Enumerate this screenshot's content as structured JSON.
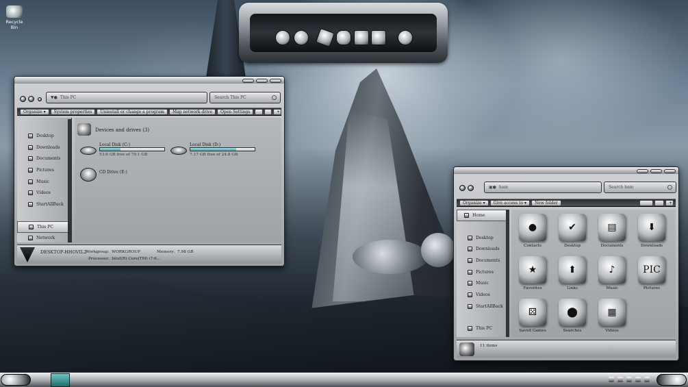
{
  "desktop": {
    "recycle_bin": "Recycle Bin"
  },
  "window1": {
    "address": "This PC",
    "search_placeholder": "Search This PC",
    "commands": [
      "Organize ▾",
      "System properties",
      "Uninstall or change a program",
      "Map network drive",
      "Open Settings"
    ],
    "nav_items": [
      "Desktop",
      "Downloads",
      "Documents",
      "Pictures",
      "Music",
      "Videos",
      "StartAllBack"
    ],
    "nav_selected": "This PC",
    "nav_network": "Network",
    "group_title": "Devices and drives (3)",
    "drives": [
      {
        "name": "Local Disk (C:)",
        "free": "53.6 GB free of 79.1 GB",
        "used_fraction": 0.32
      },
      {
        "name": "Local Disk (D:)",
        "free": "7.17 GB free of 24.8 GB",
        "used_fraction": 0.71
      }
    ],
    "cd_drive": "CD Drive (E:)",
    "status": {
      "computer": "DESKTOP-HHOVIL2",
      "workgroup_label": "Workgroup:",
      "workgroup": "WORKGROUP",
      "memory_label": "Memory:",
      "memory": "7.98 GB",
      "processor_label": "Processor:",
      "processor": "Intel(R) Core(TM) i7-6..."
    }
  },
  "window2": {
    "address": "ham",
    "search_placeholder": "Search ham",
    "commands": [
      "Organize ▾",
      "Give access to ▾",
      "New folder"
    ],
    "home": "Home",
    "nav_items": [
      "Desktop",
      "Downloads",
      "Documents",
      "Pictures",
      "Music",
      "Videos",
      "StartAllBack"
    ],
    "nav_thispc": "This PC",
    "items": [
      "Contacts",
      "Desktop",
      "Documents",
      "Downloads",
      "Favorites",
      "Links",
      "Music",
      "Pictures",
      "Saved Games",
      "Searches",
      "Videos"
    ],
    "item_glyphs": [
      "●",
      "✔",
      "▤",
      "⬇",
      "★",
      "⬆",
      "♪",
      "PIC",
      "⚄",
      "⬤",
      "▦"
    ],
    "status": "11 items"
  }
}
